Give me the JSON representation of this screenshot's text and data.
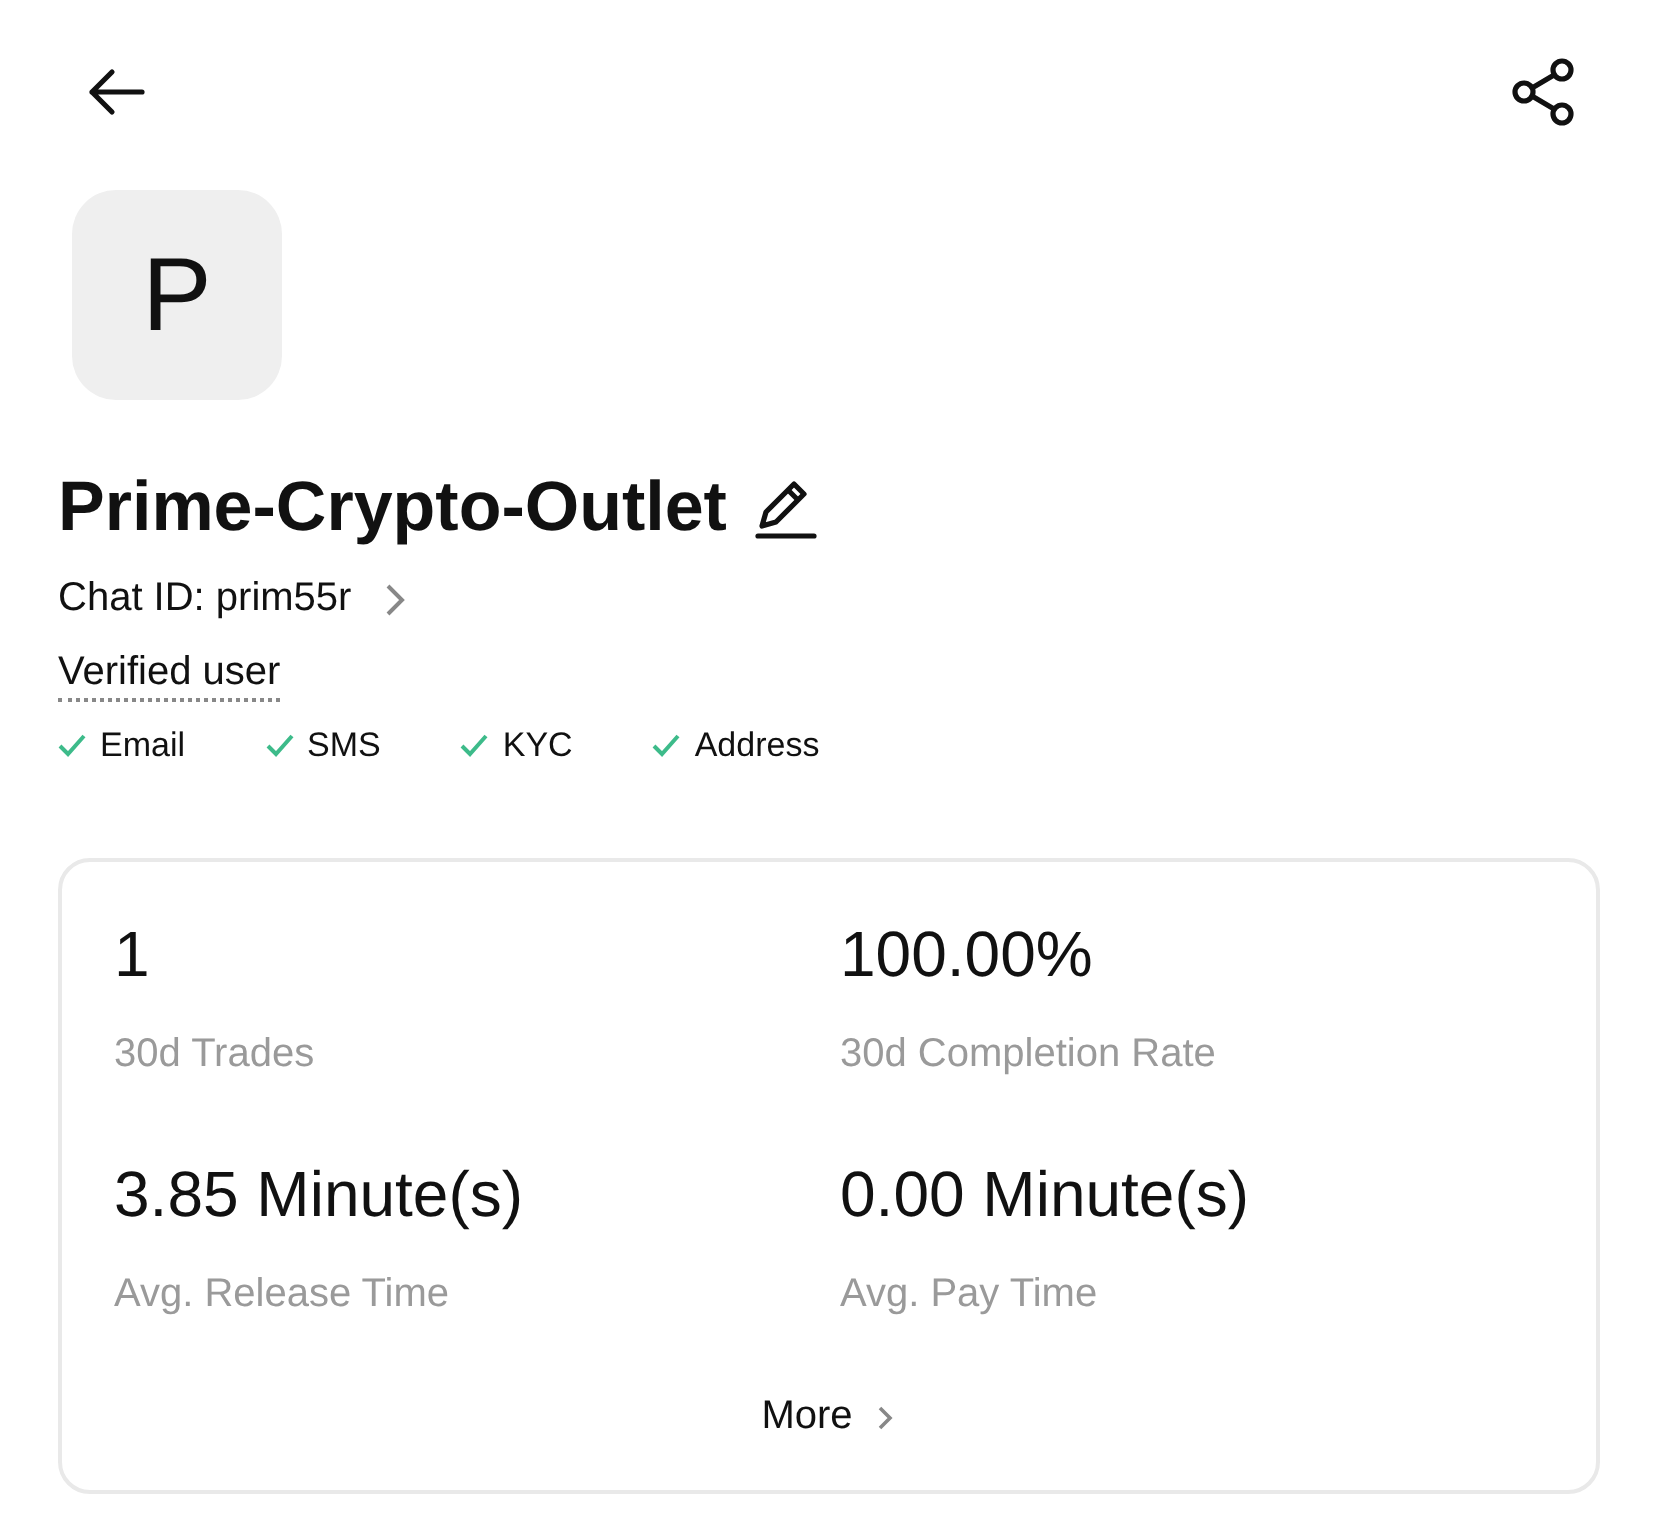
{
  "profile": {
    "avatar_letter": "P",
    "name": "Prime-Crypto-Outlet",
    "chat_id": "Chat ID: prim55r",
    "verified_label": "Verified user"
  },
  "verifications": [
    {
      "label": "Email",
      "checked": true
    },
    {
      "label": "SMS",
      "checked": true
    },
    {
      "label": "KYC",
      "checked": true
    },
    {
      "label": "Address",
      "checked": true
    }
  ],
  "stats": [
    {
      "value": "1",
      "label": "30d Trades"
    },
    {
      "value": "100.00%",
      "label": "30d Completion Rate"
    },
    {
      "value": "3.85 Minute(s)",
      "label": "Avg. Release Time"
    },
    {
      "value": "0.00 Minute(s)",
      "label": "Avg. Pay Time"
    }
  ],
  "more_button": "More"
}
